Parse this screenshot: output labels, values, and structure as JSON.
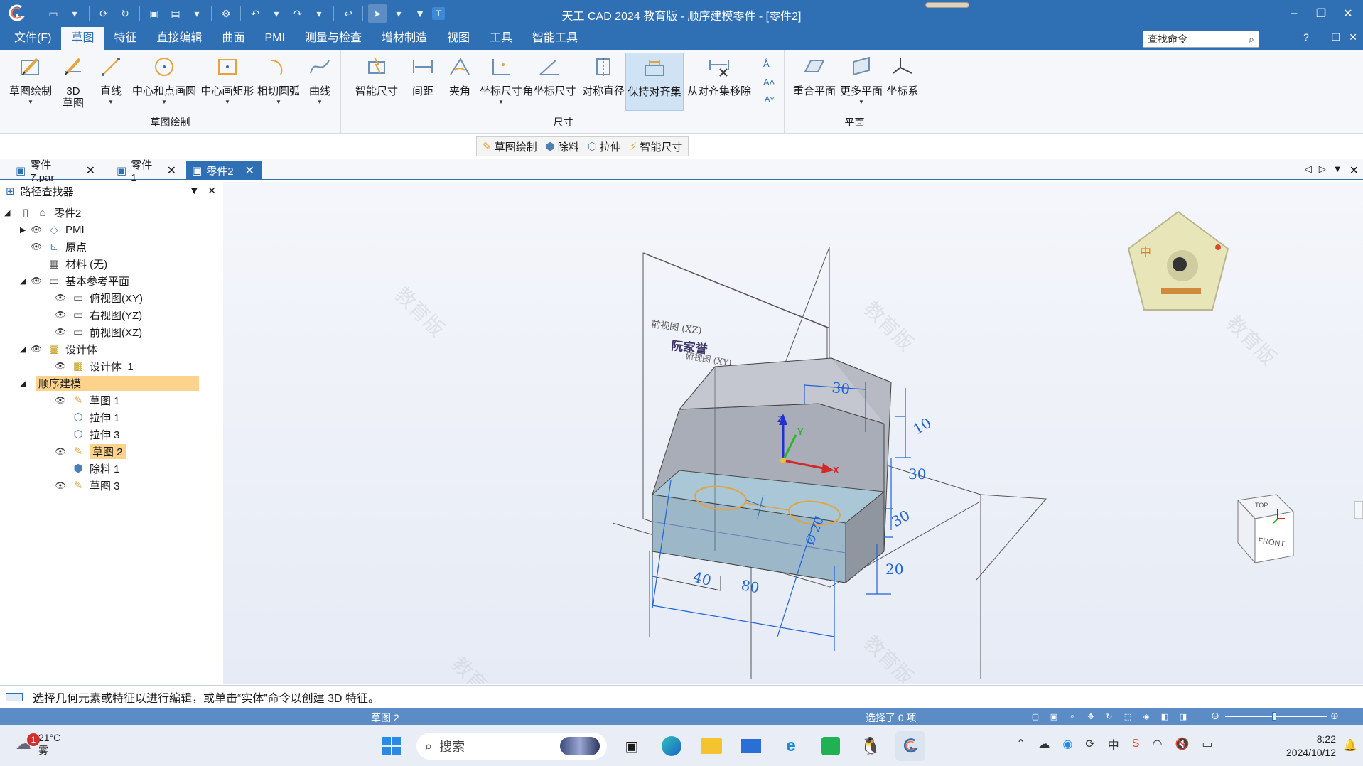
{
  "window": {
    "title": "天工 CAD 2024 教育版 - 顺序建模零件 - [零件2]",
    "accent": "#2f6fb3",
    "controls": [
      "minimize-icon",
      "restore-icon",
      "close-icon"
    ]
  },
  "menu": {
    "file": "文件(F)",
    "tabs": [
      "草图",
      "特征",
      "直接编辑",
      "曲面",
      "PMI",
      "测量与检查",
      "增材制造",
      "视图",
      "工具",
      "智能工具"
    ],
    "active_tab": "草图",
    "search_placeholder": "查找命令",
    "help": "?"
  },
  "ribbon": {
    "sketch_group": {
      "label": "草图绘制",
      "buttons": [
        "草图绘制",
        "3D\n草图",
        "直线",
        "中心和点画圆",
        "中心画矩形",
        "相切圆弧",
        "曲线"
      ]
    },
    "dimension_group": {
      "label": "尺寸",
      "buttons": [
        "智能尺寸",
        "间距",
        "夹角",
        "坐标尺寸",
        "角坐标尺寸",
        "对称直径",
        "保持对齐集",
        "从对齐集移除"
      ]
    },
    "plane_group": {
      "label": "平面",
      "buttons": [
        "重合平面",
        "更多平面",
        "坐标系"
      ]
    }
  },
  "command_bar": [
    "草图绘制",
    "除料",
    "拉伸",
    "智能尺寸"
  ],
  "doc_tabs": [
    {
      "label": "零件7.par",
      "active": false
    },
    {
      "label": "零件1",
      "active": false
    },
    {
      "label": "零件2",
      "active": true
    }
  ],
  "pathfinder": {
    "title": "路径查找器",
    "items": [
      {
        "label": "零件2"
      },
      {
        "label": "PMI"
      },
      {
        "label": "原点"
      },
      {
        "label": "材料 (无)"
      },
      {
        "label": "基本参考平面"
      },
      {
        "label": "俯视图(XY)"
      },
      {
        "label": "右视图(YZ)"
      },
      {
        "label": "前视图(XZ)"
      },
      {
        "label": "设计体"
      },
      {
        "label": "设计体_1"
      },
      {
        "label": "顺序建模"
      },
      {
        "label": "草图 1"
      },
      {
        "label": "拉伸 1"
      },
      {
        "label": "拉伸 3"
      },
      {
        "label": "草图 2"
      },
      {
        "label": "除料 1"
      },
      {
        "label": "草图 3"
      }
    ]
  },
  "viewport": {
    "plane_label_front": "前视图 (XZ)",
    "plane_label_top": "俯视图 (XY)",
    "author_text": "阮家誉",
    "watermark": "教育版",
    "dims": [
      "30",
      "10",
      "30",
      "30",
      "20",
      "80",
      "40",
      "Ø 20"
    ],
    "axes": {
      "z": "Z",
      "y": "Y",
      "x": "X"
    },
    "viewcube_top": "TOP",
    "viewcube_front": "FRONT"
  },
  "prompt": "选择几何元素或特征以进行编辑，或单击“实体”命令以创建 3D 特征。",
  "status": {
    "active_feature": "草图 2",
    "selection": "选择了 0 项"
  },
  "taskbar": {
    "weather_temp": "21°C",
    "weather_desc": "雾",
    "weather_badge": "1",
    "search_placeholder": "搜索",
    "time": "8:22",
    "date": "2024/10/12",
    "ime": "中"
  }
}
